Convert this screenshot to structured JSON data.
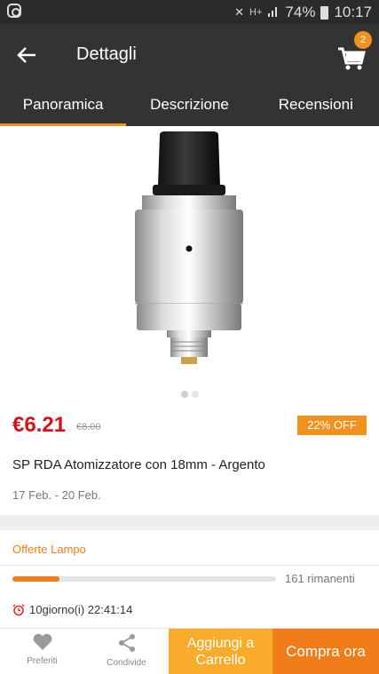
{
  "status": {
    "battery": "74%",
    "time": "10:17",
    "network": "H+"
  },
  "header": {
    "title": "Dettagli",
    "cart_count": "2"
  },
  "tabs": [
    {
      "label": "Panoramica",
      "active": true
    },
    {
      "label": "Descrizione",
      "active": false
    },
    {
      "label": "Recensioni",
      "active": false
    }
  ],
  "product": {
    "price": "€6.21",
    "old_price": "€8.00",
    "discount": "22% OFF",
    "title": "SP RDA Atomizzatore con 18mm - Argento",
    "shipping_dates": "17 Feb. - 20 Feb.",
    "image_pages": 2,
    "image_current": 1
  },
  "flash_sale": {
    "title": "Offerte Lampo",
    "progress_fraction": 0.18,
    "remaining": "161 rimanenti",
    "countdown": "10giorno(i) 22:41:14"
  },
  "bottom": {
    "favorites": "Preferiti",
    "share": "Condivide",
    "add_to_cart": "Aggiungi a Carrello",
    "buy_now": "Compra ora"
  },
  "colors": {
    "accent": "#f07d1a",
    "price": "#d0131b",
    "header": "#333333"
  }
}
